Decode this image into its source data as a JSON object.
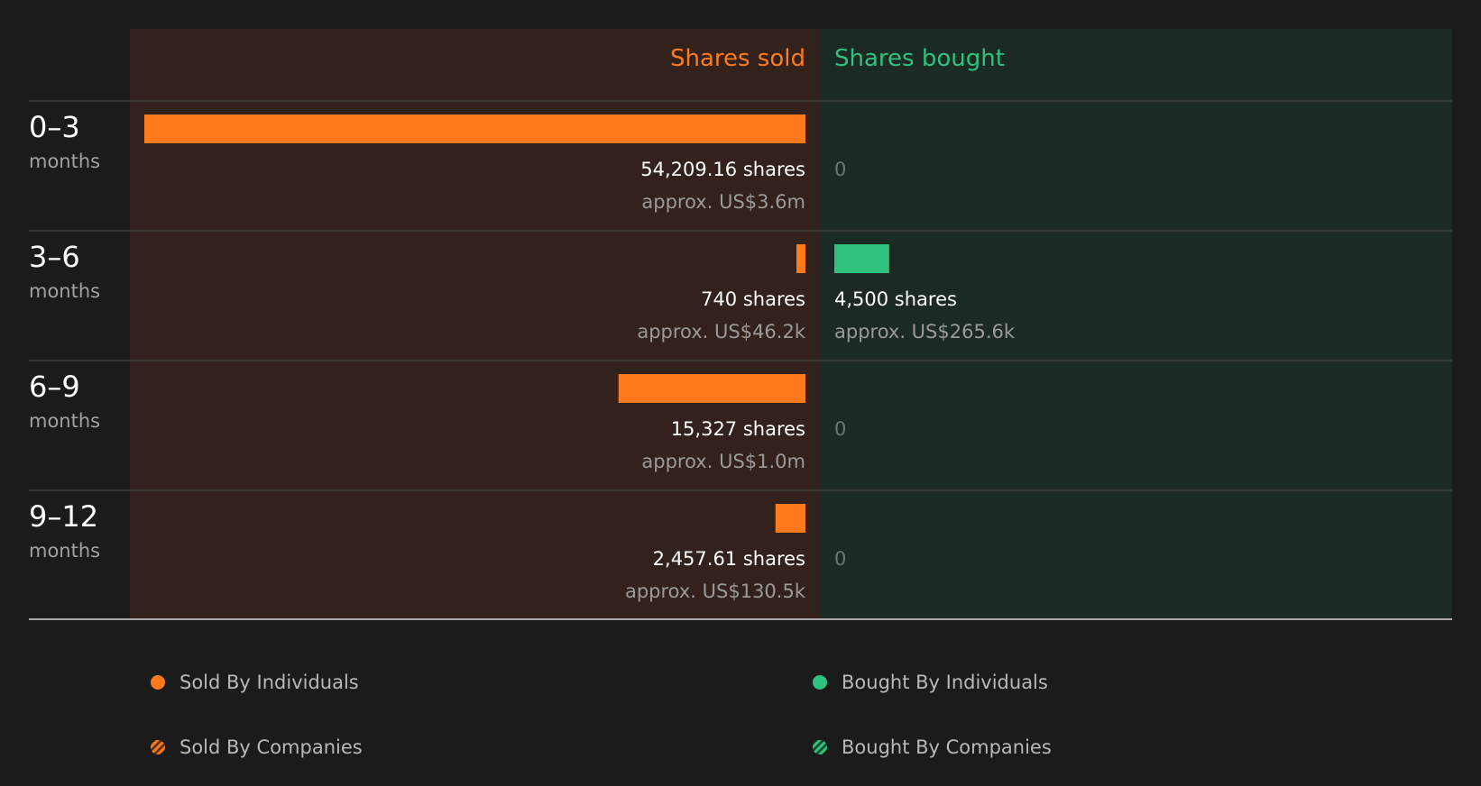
{
  "header": {
    "sold_label": "Shares sold",
    "bought_label": "Shares bought"
  },
  "colors": {
    "sold": "#ff7a1a",
    "bought": "#2ec27e",
    "sold_panel": "#32221b",
    "bought_panel": "#1b2a23"
  },
  "chart_data": {
    "type": "bar",
    "categories": [
      "0–3 months",
      "3–6 months",
      "6–9 months",
      "9–12 months"
    ],
    "series": [
      {
        "name": "Shares sold",
        "values": [
          54209.16,
          740,
          15327,
          2457.61
        ]
      },
      {
        "name": "Shares bought",
        "values": [
          0,
          4500,
          0,
          0
        ]
      }
    ],
    "rows": [
      {
        "period": "0–3",
        "unit": "months",
        "sold_shares": "54,209.16 shares",
        "sold_approx": "approx. US$3.6m",
        "bought_shares": "0",
        "bought_approx": ""
      },
      {
        "period": "3–6",
        "unit": "months",
        "sold_shares": "740 shares",
        "sold_approx": "approx. US$46.2k",
        "bought_shares": "4,500 shares",
        "bought_approx": "approx. US$265.6k"
      },
      {
        "period": "6–9",
        "unit": "months",
        "sold_shares": "15,327 shares",
        "sold_approx": "approx. US$1.0m",
        "bought_shares": "0",
        "bought_approx": ""
      },
      {
        "period": "9–12",
        "unit": "months",
        "sold_shares": "2,457.61 shares",
        "sold_approx": "approx. US$130.5k",
        "bought_shares": "0",
        "bought_approx": ""
      }
    ]
  },
  "legend": [
    {
      "label": "Sold By Individuals",
      "style": "dot",
      "color": "#ff7a1a"
    },
    {
      "label": "Bought By Individuals",
      "style": "dot",
      "color": "#2ec27e"
    },
    {
      "label": "Sold By Companies",
      "style": "hatched",
      "color": "#ff7a1a"
    },
    {
      "label": "Bought By Companies",
      "style": "hatched",
      "color": "#2ec27e"
    }
  ]
}
